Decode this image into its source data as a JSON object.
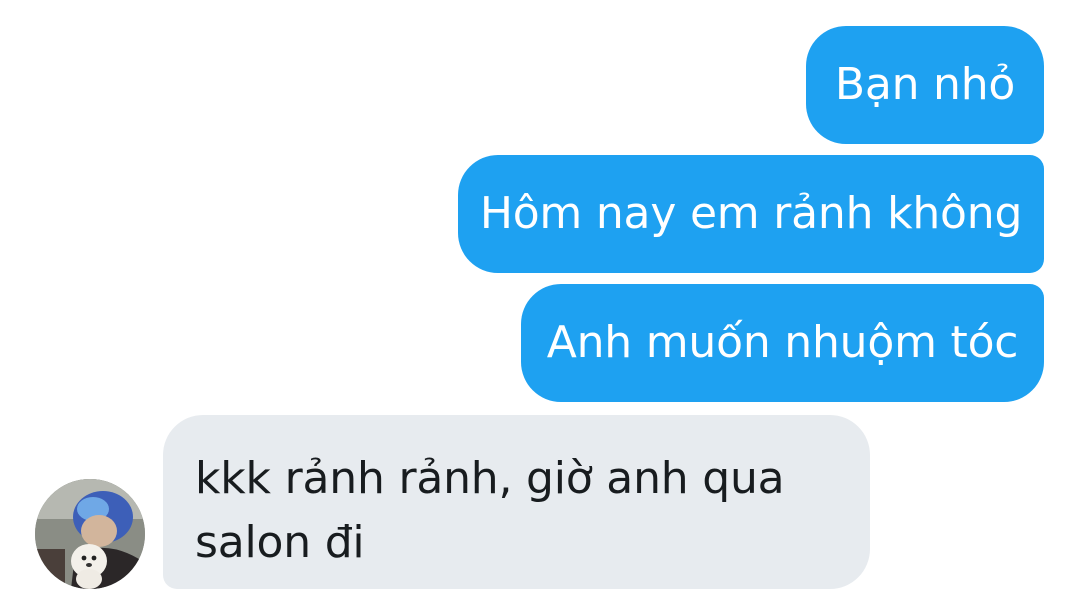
{
  "messages": {
    "sent": [
      {
        "text": "Bạn nhỏ"
      },
      {
        "text": "Hôm nay em rảnh không"
      },
      {
        "text": "Anh muốn nhuộm tóc"
      }
    ],
    "received": {
      "lines": [
        "kkk rảnh rảnh, giờ anh qua",
        "salon đi"
      ]
    }
  },
  "colors": {
    "sent_bubble": "#1ea1f1",
    "received_bubble": "#e7ebef",
    "background": "#ffffff"
  },
  "icons": {
    "avatar": "user-avatar-photo"
  }
}
